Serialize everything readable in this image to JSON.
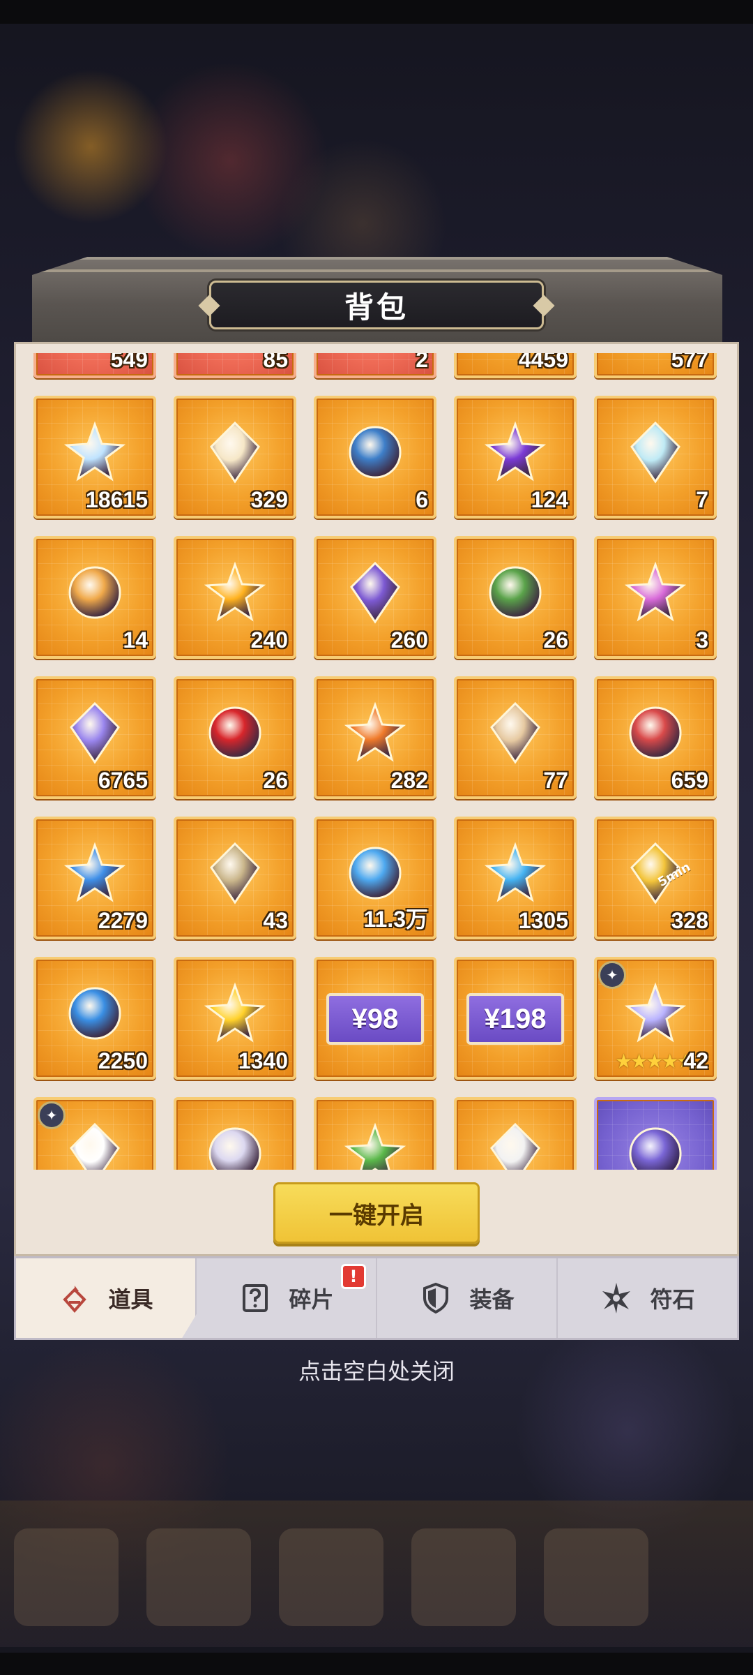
{
  "window": {
    "title": "背包"
  },
  "items": [
    {
      "count": "549",
      "icon": "blue-wings-crystal-icon",
      "color": "#6fa3e8",
      "rarity": "red"
    },
    {
      "count": "85",
      "icon": "ruby-crown-icon",
      "color": "#e0424b",
      "rarity": "red"
    },
    {
      "count": "2",
      "icon": "flame-emblem-icon",
      "color": "#f08a3a",
      "rarity": "red"
    },
    {
      "count": "4459",
      "icon": "gold-tablet-icon",
      "color": "#e8b54a",
      "rarity": "gold"
    },
    {
      "count": "577",
      "icon": "gold-star-icon",
      "color": "#ffd34a",
      "rarity": "gold"
    },
    {
      "count": "18615",
      "icon": "rainbow-drop-icon",
      "color": "#bfe3ff",
      "rarity": "gold"
    },
    {
      "count": "329",
      "icon": "crystal-flower-icon",
      "color": "#f6e7c7",
      "rarity": "gold"
    },
    {
      "count": "6",
      "icon": "blue-orb-ring-icon",
      "color": "#3e7fc9",
      "rarity": "gold"
    },
    {
      "count": "124",
      "icon": "purple-planet-icon",
      "color": "#7b3bd6",
      "rarity": "gold"
    },
    {
      "count": "7",
      "icon": "ice-star-icon",
      "color": "#bfeaf5",
      "rarity": "gold"
    },
    {
      "count": "14",
      "icon": "jeweled-medallion-icon",
      "color": "#f0a94a",
      "rarity": "gold"
    },
    {
      "count": "240",
      "icon": "amber-crystal-icon",
      "color": "#ffb21f",
      "rarity": "gold"
    },
    {
      "count": "260",
      "icon": "puzzle-piece-icon",
      "color": "#7d5ad3",
      "rarity": "gold"
    },
    {
      "count": "26",
      "icon": "green-leaf-bundle-icon",
      "color": "#5aa34a",
      "rarity": "gold"
    },
    {
      "count": "3",
      "icon": "pink-rune-crystal-icon",
      "color": "#d86ad9",
      "rarity": "gold"
    },
    {
      "count": "6765",
      "icon": "crossed-crystals-icon",
      "color": "#9a86ee",
      "rarity": "gold"
    },
    {
      "count": "26",
      "icon": "red-flame-crown-icon",
      "color": "#d8262b",
      "rarity": "gold"
    },
    {
      "count": "282",
      "icon": "orange-orb-lotus-icon",
      "color": "#f07a2a",
      "rarity": "gold"
    },
    {
      "count": "77",
      "icon": "map-scroll-icon",
      "color": "#e6c9a1",
      "rarity": "gold"
    },
    {
      "count": "659",
      "icon": "canned-food-icon",
      "color": "#d94a4a",
      "rarity": "gold"
    },
    {
      "count": "2279",
      "icon": "blue-gem-rock-icon",
      "color": "#3f8fe8",
      "rarity": "gold"
    },
    {
      "count": "43",
      "icon": "ancient-scroll-icon",
      "color": "#c9b58a",
      "rarity": "gold"
    },
    {
      "count": "11.3万",
      "icon": "ice-cube-icon",
      "color": "#4ea9f0",
      "rarity": "gold"
    },
    {
      "count": "1305",
      "icon": "blue-potion-icon",
      "color": "#45b3f2",
      "rarity": "gold"
    },
    {
      "count": "328",
      "icon": "speedup-ticket-icon",
      "color": "#f3c43a",
      "rarity": "gold",
      "ticket_text": "5min"
    },
    {
      "count": "2250",
      "icon": "blue-crystal-pedestal-icon",
      "color": "#3a8fe4",
      "rarity": "gold"
    },
    {
      "count": "1340",
      "icon": "gold-feather-icon",
      "color": "#ffd12a",
      "rarity": "gold"
    },
    {
      "count": "",
      "icon": "price-card-icon",
      "color": "#7a5ad6",
      "rarity": "gold",
      "price": "¥98"
    },
    {
      "count": "",
      "icon": "price-card-icon",
      "color": "#7a5ad6",
      "rarity": "gold",
      "price": "¥198"
    },
    {
      "count": "42",
      "icon": "hero-silhouette-icon",
      "color": "#b9b3ff",
      "rarity": "gold",
      "stars": "★★★★★",
      "badge": true
    },
    {
      "count": "",
      "icon": "white-orb-icon",
      "color": "#ffffff",
      "rarity": "gold",
      "badge": true
    },
    {
      "count": "",
      "icon": "silver-crystal-icon",
      "color": "#dcd8f0",
      "rarity": "gold"
    },
    {
      "count": "",
      "icon": "green-serpent-icon",
      "color": "#5ab84a",
      "rarity": "gold"
    },
    {
      "count": "",
      "icon": "white-creature-icon",
      "color": "#f2f2f2",
      "rarity": "gold"
    },
    {
      "count": "",
      "icon": "purple-emblem-icon",
      "color": "#7a66d6",
      "rarity": "purple"
    }
  ],
  "actions": {
    "open_all": "一键开启"
  },
  "tabs": [
    {
      "label": "道具",
      "icon": "item-bag-icon",
      "active": true,
      "alert": false
    },
    {
      "label": "碎片",
      "icon": "question-fragment-icon",
      "active": false,
      "alert": true
    },
    {
      "label": "装备",
      "icon": "shield-icon",
      "active": false,
      "alert": false
    },
    {
      "label": "符石",
      "icon": "rune-star-icon",
      "active": false,
      "alert": false
    }
  ],
  "alert_mark": "!",
  "hint": "点击空白处关闭"
}
